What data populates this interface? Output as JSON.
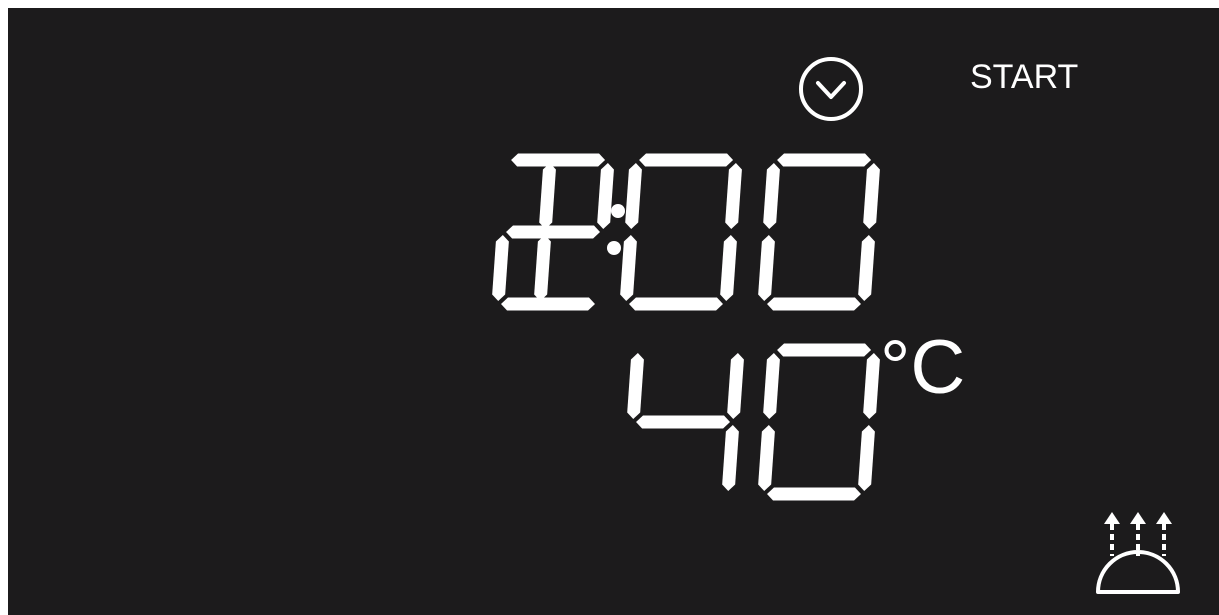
{
  "display": {
    "start_label": "START",
    "time_digits": [
      "1",
      "2",
      "0",
      "0"
    ],
    "time_text": "12:00",
    "temperature_digits": [
      "4",
      "0"
    ],
    "temperature_value": "40",
    "temperature_unit": "°C"
  },
  "icons": {
    "timer": "clock-chevron-icon",
    "heating": "heat-rising-dome-icon"
  },
  "colors": {
    "background": "#1c1b1c",
    "foreground": "#ffffff"
  }
}
